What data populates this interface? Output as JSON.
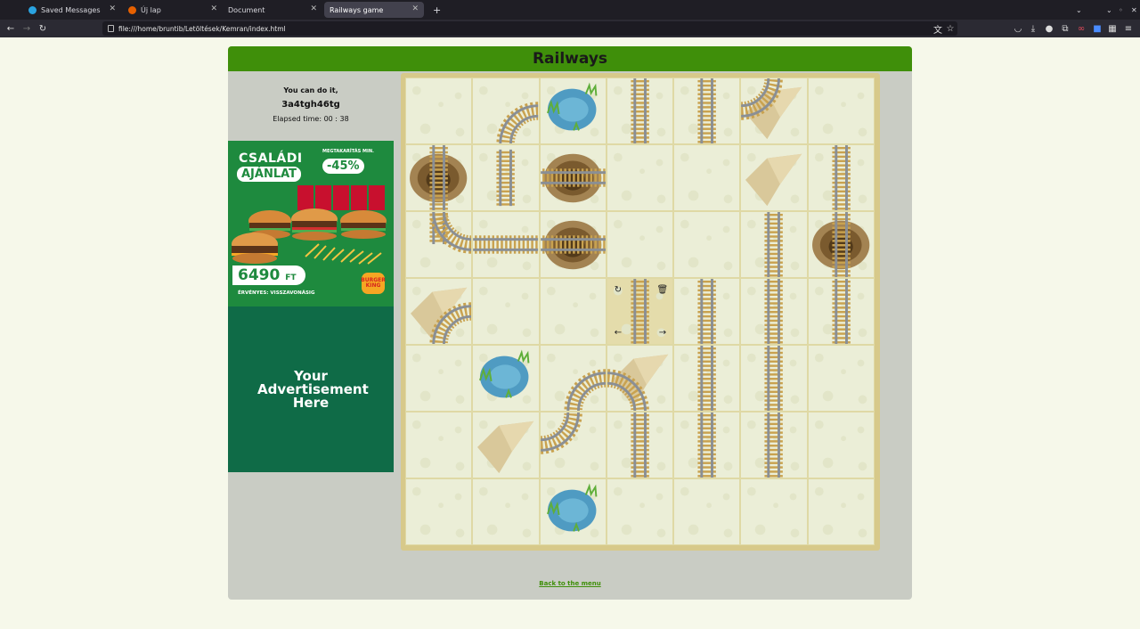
{
  "browser": {
    "tabs": [
      {
        "label": "Saved Messages",
        "color": "#2aa3e0"
      },
      {
        "label": "Új lap",
        "color": "#e66000"
      },
      {
        "label": "Document",
        "color": "#888888"
      },
      {
        "label": "Railways game",
        "color": "#888888"
      }
    ],
    "url": "file:///home/bruntib/Letöltések/Kemran/index.html"
  },
  "game": {
    "title": "Railways",
    "message": "You can do it,",
    "player": "3a4tgh46tg",
    "elapsed": "Elapsed time: 00 : 38",
    "back_link": "Back to the menu",
    "accent_color": "#3f8f0a"
  },
  "ad1": {
    "headline1": "CSALÁDI",
    "headline2": "AJÁNLAT",
    "promo_small": "MEGTAKARÍTÁS MIN.",
    "discount": "-45%",
    "price": "6490",
    "currency": "FT",
    "validity": "ÉRVÉNYES: VISSZAVONÁSIG",
    "brand_line1": "BURGER",
    "brand_line2": "KING"
  },
  "ad2": {
    "text": "Your Advertisement Here"
  },
  "grid": {
    "rows": 7,
    "cols": 7,
    "cells": [
      [
        "empty",
        "curve-se-wide",
        "lake",
        "rail-v",
        "rail-v",
        "curve-nw-rock",
        "empty"
      ],
      [
        "rail-v-hole",
        "rail-v-short",
        "hole-rail-h",
        "empty",
        "empty",
        "rock",
        "rail-v"
      ],
      [
        "curve-ne-long",
        "rail-h",
        "hole-rail-h",
        "empty",
        "empty",
        "rail-v",
        "hole-rail-v"
      ],
      [
        "rock-curve",
        "empty",
        "empty",
        "selected-rail-v",
        "rail-v",
        "rail-v",
        "rail-v"
      ],
      [
        "empty",
        "lake",
        "curve-se",
        "curve-sw-rock",
        "rail-v",
        "rail-v",
        "empty"
      ],
      [
        "empty",
        "rock",
        "curve-nw",
        "rail-v",
        "rail-v",
        "rail-v",
        "empty"
      ],
      [
        "empty",
        "empty",
        "lake",
        "empty",
        "empty",
        "empty",
        "empty"
      ]
    ]
  }
}
